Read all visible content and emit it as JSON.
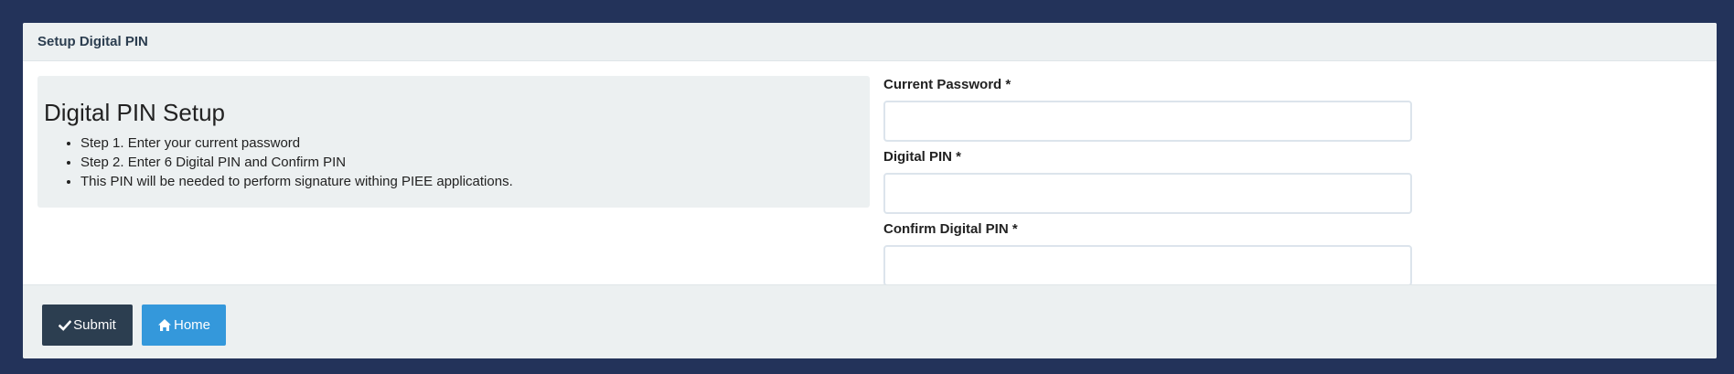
{
  "panel": {
    "title": "Setup Digital PIN"
  },
  "info": {
    "heading": "Digital PIN Setup",
    "steps": [
      "Step 1. Enter your current password",
      "Step 2. Enter 6 Digital PIN and Confirm PIN",
      "This PIN will be needed to perform signature withing PIEE applications."
    ]
  },
  "form": {
    "current_password": {
      "label": "Current Password *",
      "value": ""
    },
    "digital_pin": {
      "label": "Digital PIN *",
      "value": ""
    },
    "confirm_pin": {
      "label": "Confirm Digital PIN *",
      "value": ""
    }
  },
  "buttons": {
    "submit": {
      "label": "Submit",
      "icon": "check-icon",
      "color": "#2c3e50"
    },
    "home": {
      "label": "Home",
      "icon": "home-icon",
      "color": "#3498db"
    }
  },
  "colors": {
    "background": "#23335a",
    "panel_header": "#ecf0f1"
  }
}
